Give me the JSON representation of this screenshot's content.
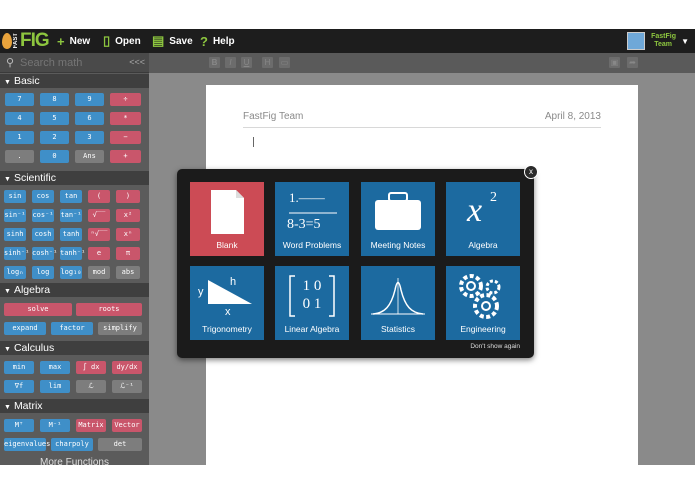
{
  "topbar": {
    "logo_text": "FIG",
    "logo_small": "FAST",
    "new_label": "New",
    "open_label": "Open",
    "save_label": "Save",
    "help_label": "Help",
    "user_name_line1": "FastFig",
    "user_name_line2": "Team"
  },
  "sidebar": {
    "search_placeholder": "Search math",
    "collapse_label": "<<<",
    "sections": {
      "basic": "Basic",
      "scientific": "Scientific",
      "algebra": "Algebra",
      "calculus": "Calculus",
      "matrix": "Matrix",
      "more": "More Functions"
    },
    "basic_keys": [
      "7",
      "8",
      "9",
      "÷",
      "4",
      "5",
      "6",
      "*",
      "1",
      "2",
      "3",
      "−",
      ".",
      "0",
      "Ans",
      "+"
    ],
    "sci_keys": [
      "sin",
      "cos",
      "tan",
      "(",
      ")",
      "sin⁻¹",
      "cos⁻¹",
      "tan⁻¹",
      "√‾‾",
      "x²",
      "sinh",
      "cosh",
      "tanh",
      "ⁿ√‾‾",
      "xⁿ",
      "sinh⁻¹",
      "cosh⁻¹",
      "tanh⁻¹",
      "e",
      "π",
      "logₙ",
      "log",
      "log₁₀",
      "mod",
      "abs"
    ],
    "alg_keys": [
      "solve",
      "roots",
      "expand",
      "factor",
      "simplify"
    ],
    "calc_keys": [
      "min",
      "max",
      "∫ dx",
      "dy/dx",
      "∇f",
      "lim",
      "ℒ",
      "ℒ⁻¹"
    ],
    "matrix_keys": [
      "Mᵀ",
      "M⁻¹",
      "Matrix",
      "Vector",
      "eigenvalues",
      "charpoly",
      "det"
    ]
  },
  "format_toolbar": {
    "bold": "B",
    "italic": "I",
    "underline": "U",
    "heading": "H"
  },
  "document": {
    "author": "FastFig Team",
    "date": "April 8, 2013"
  },
  "template_dialog": {
    "close": "x",
    "tiles": [
      {
        "label": "Blank"
      },
      {
        "label": "Word Problems",
        "art_top": "1.——",
        "art_bottom": "8-3=5"
      },
      {
        "label": "Meeting Notes"
      },
      {
        "label": "Algebra",
        "art": "x",
        "art_exp": "2"
      },
      {
        "label": "Trigonometry",
        "art_y": "y",
        "art_h": "h",
        "art_x": "x"
      },
      {
        "label": "Linear Algebra",
        "art_row1": "1 0",
        "art_row2": "0 1"
      },
      {
        "label": "Statistics"
      },
      {
        "label": "Engineering"
      }
    ],
    "dont_show": "Don't show again"
  },
  "colors": {
    "accent_green": "#8dc63f",
    "tile_blue": "#1c6aa0",
    "tile_red": "#cc4b55",
    "key_blue": "#3f8fc8",
    "key_red": "#c9566b"
  }
}
